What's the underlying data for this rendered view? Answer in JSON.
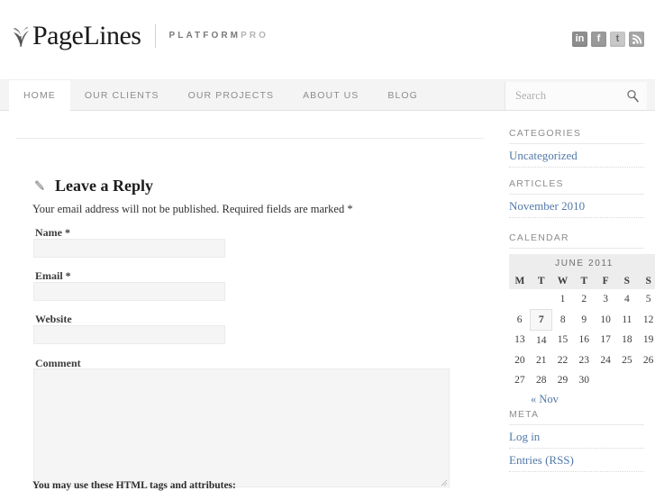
{
  "header": {
    "logo_text": "PageLines",
    "leaf_icon": "leaf-icon",
    "tagline_platform": "PLATFORM",
    "tagline_pro": "PRO",
    "social": [
      {
        "name": "linkedin",
        "glyph": "in"
      },
      {
        "name": "facebook",
        "glyph": "f"
      },
      {
        "name": "twitter",
        "glyph": "t"
      },
      {
        "name": "rss",
        "glyph": "◔"
      }
    ]
  },
  "nav": {
    "items": [
      {
        "label": "HOME",
        "active": true
      },
      {
        "label": "OUR CLIENTS",
        "active": false
      },
      {
        "label": "OUR PROJECTS",
        "active": false
      },
      {
        "label": "ABOUT US",
        "active": false
      },
      {
        "label": "BLOG",
        "active": false
      }
    ]
  },
  "search": {
    "placeholder": "Search",
    "value": "",
    "icon": "search-icon"
  },
  "comment_form": {
    "heading": "Leave a Reply",
    "heading_icon": "pencil-icon",
    "note": "Your email address will not be published. Required fields are marked *",
    "fields": [
      {
        "label": "Name *",
        "value": "",
        "name": "name"
      },
      {
        "label": "Email *",
        "value": "",
        "name": "email"
      },
      {
        "label": "Website",
        "value": "",
        "name": "website"
      }
    ],
    "comment_label": "Comment",
    "comment_value": "",
    "allowed_tags_text": "You may use these HTML tags and attributes:"
  },
  "sidebar": {
    "categories": {
      "title": "CATEGORIES",
      "links": [
        "Uncategorized"
      ]
    },
    "articles": {
      "title": "ARTICLES",
      "links": [
        "November 2010"
      ]
    },
    "calendar": {
      "title": "CALENDAR",
      "caption": "JUNE 2011",
      "weekdays": [
        "M",
        "T",
        "W",
        "T",
        "F",
        "S",
        "S"
      ],
      "weeks": [
        [
          "",
          "",
          "1",
          "2",
          "3",
          "4",
          "5"
        ],
        [
          "6",
          "7",
          "8",
          "9",
          "10",
          "11",
          "12"
        ],
        [
          "13",
          "14",
          "15",
          "16",
          "17",
          "18",
          "19"
        ],
        [
          "20",
          "21",
          "22",
          "23",
          "24",
          "25",
          "26"
        ],
        [
          "27",
          "28",
          "29",
          "30",
          "",
          "",
          ""
        ]
      ],
      "today": "7",
      "prev_label": "« Nov"
    },
    "meta": {
      "title": "META",
      "links": [
        "Log in",
        "Entries (RSS)"
      ]
    }
  },
  "colors": {
    "link": "#5279a8",
    "nav_bg": "#f4f4f4",
    "input_bg": "#f5f5f5",
    "muted_text": "#8d8d8d"
  }
}
